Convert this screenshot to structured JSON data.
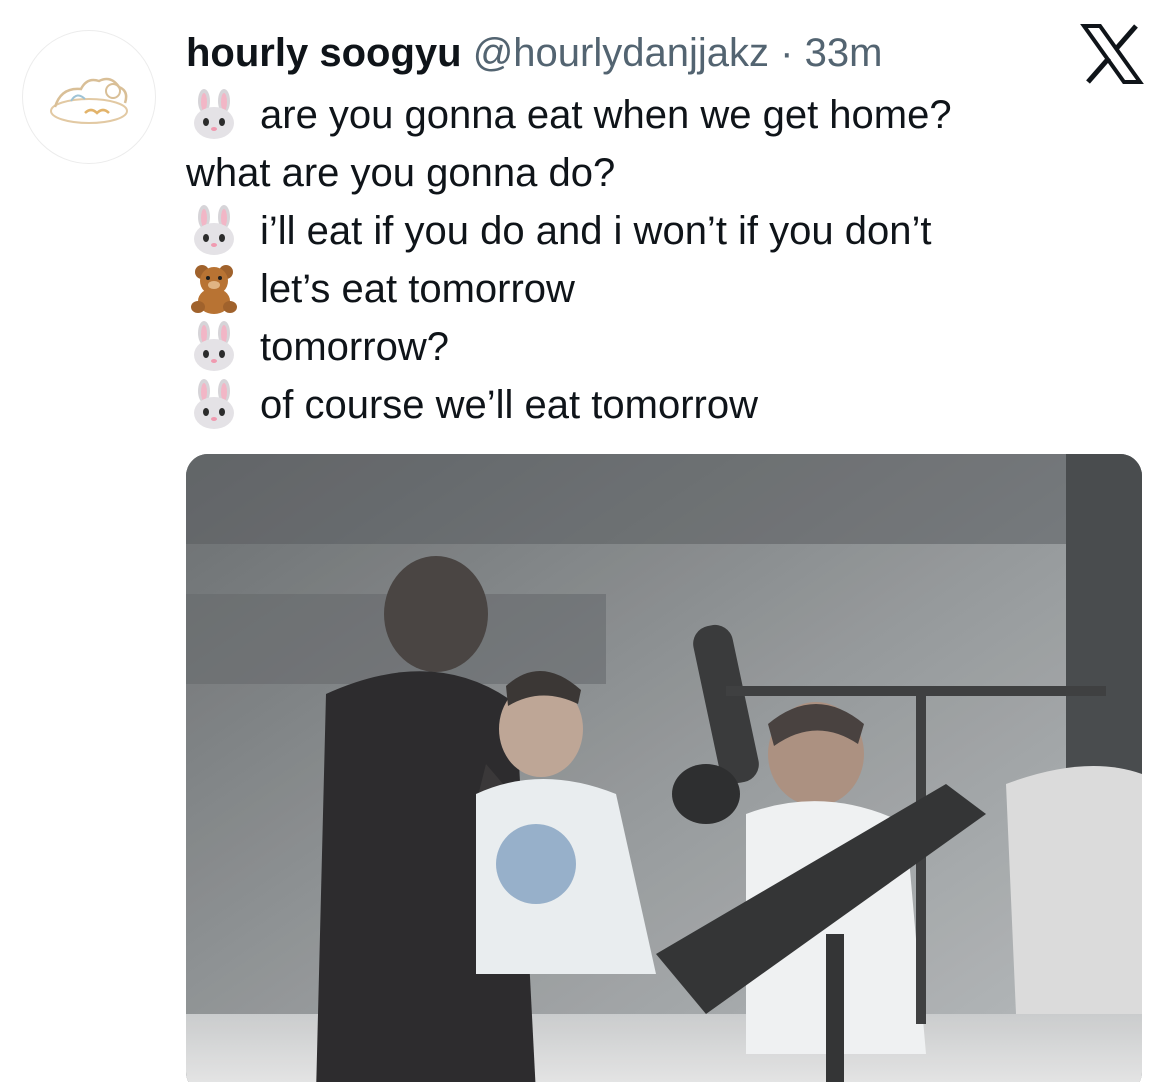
{
  "tweet": {
    "author_name": "hourly soogyu",
    "handle": "@hourlydanjjakz",
    "separator": "·",
    "time": "33m",
    "avatar_icon": "sleeping-bunny-avatar-icon",
    "platform_icon": "x-logo-icon",
    "lines": [
      {
        "emoji": "rabbit-face-icon",
        "text": "are you gonna eat when we get home?"
      },
      {
        "emoji": "",
        "text": "what are you gonna do?"
      },
      {
        "emoji": "rabbit-face-icon",
        "text": "i’ll eat if you do and i won’t if you don’t"
      },
      {
        "emoji": "teddy-bear-icon",
        "text": "let’s eat tomorrow"
      },
      {
        "emoji": "rabbit-face-icon",
        "text": "tomorrow?"
      },
      {
        "emoji": "rabbit-face-icon",
        "text": "of course we’ll eat tomorrow"
      }
    ],
    "media_type": "photo"
  }
}
